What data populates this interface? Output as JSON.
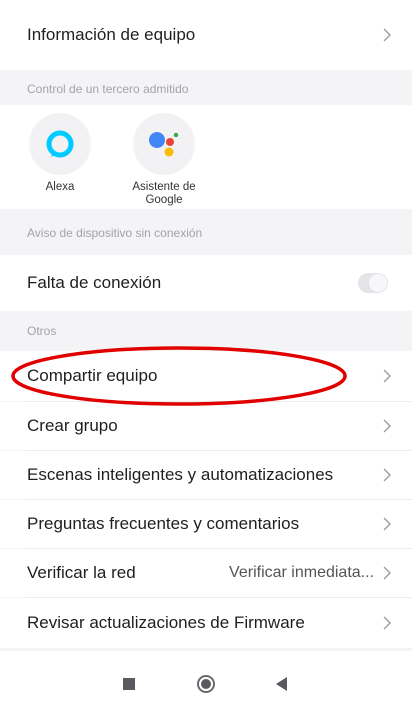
{
  "rows": {
    "device_info": "Información de equipo",
    "offline_toggle": "Falta de conexión",
    "share": "Compartir equipo",
    "create_group": "Crear grupo",
    "scenes": "Escenas inteligentes y automatizaciones",
    "faq": "Preguntas frecuentes y comentarios",
    "check_network": "Verificar la red",
    "check_network_value": "Verificar inmediata...",
    "firmware": "Revisar actualizaciones de Firmware"
  },
  "sections": {
    "third_party": "Control de un tercero admitido",
    "offline_notice": "Aviso de dispositivo sin conexión",
    "others": "Otros"
  },
  "integrations": [
    {
      "name": "Alexa",
      "icon": "alexa-icon"
    },
    {
      "name": "Asistente de Google",
      "icon": "google-assistant-icon"
    }
  ],
  "offline_toggle_on": false,
  "colors": {
    "annotation": "#e00000",
    "alexa": "#00caff",
    "google_blue": "#4285f4",
    "google_red": "#ea4335",
    "google_yellow": "#fbbc05",
    "google_green": "#34a853"
  },
  "navbar": {
    "icons": [
      "square-icon",
      "circle-home-icon",
      "back-triangle-icon"
    ]
  }
}
